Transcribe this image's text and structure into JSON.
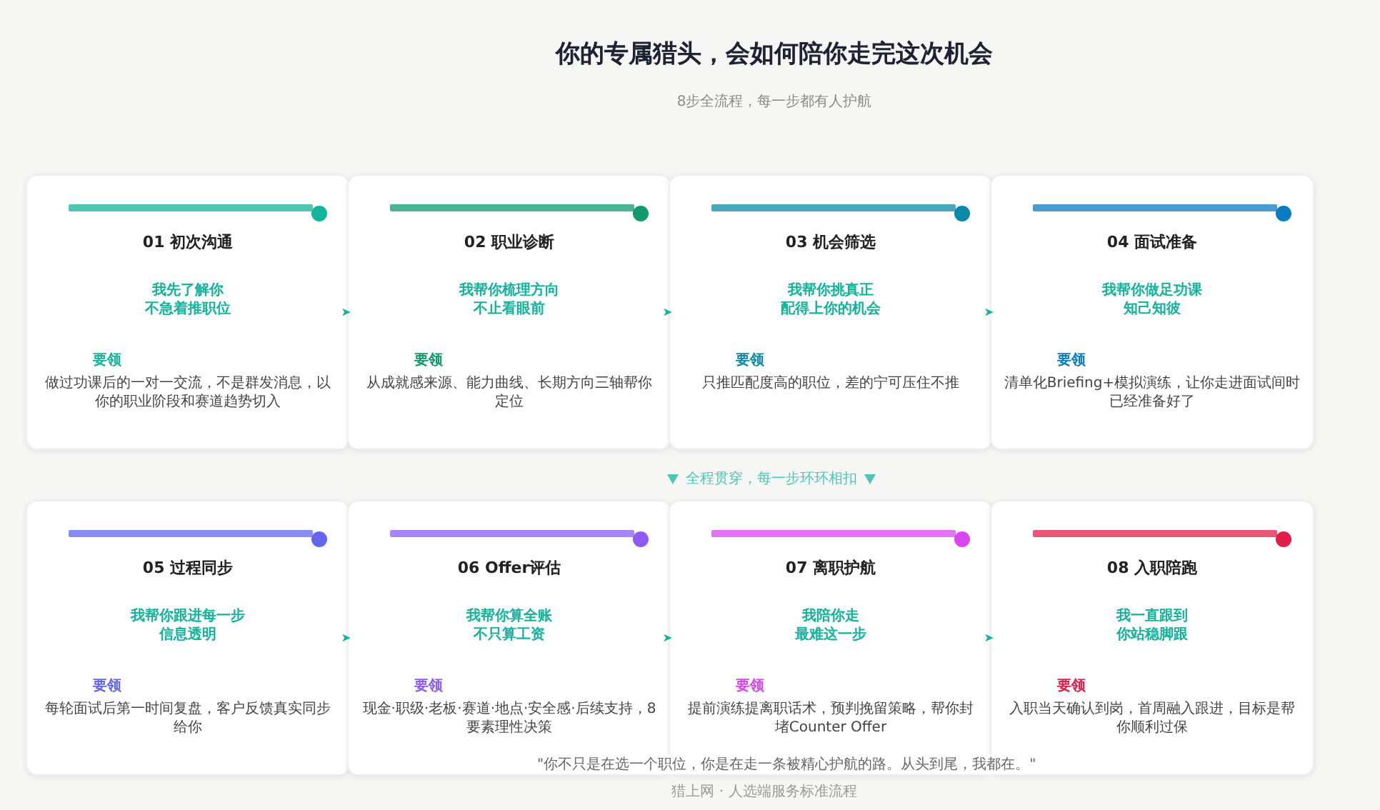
{
  "header": {
    "title": "你的专属猎头，会如何陪你走完这次机会",
    "subtitle": "8步全流程，每一步都有人护航"
  },
  "rows": [
    {
      "steps": [
        {
          "title": "01  初次沟通",
          "tagline_lines": [
            "我先了解你",
            "不急着推职位"
          ],
          "label": "要领",
          "description": "做过功课后的一对一交流，不是群发消息，以你的职业阶段和赛道趋势切入",
          "color": "#14b39b"
        },
        {
          "title": "02  职业诊断",
          "tagline_lines": [
            "我帮你梳理方向",
            "不止看眼前"
          ],
          "label": "要领",
          "description": "从成就感来源、能力曲线、长期方向三轴帮你定位",
          "color": "#0e9a6a"
        },
        {
          "title": "03  机会筛选",
          "tagline_lines": [
            "我帮你挑真正",
            "配得上你的机会"
          ],
          "label": "要领",
          "description": "只推匹配度高的职位，差的宁可压住不推",
          "color": "#0a8aa8"
        },
        {
          "title": "04  面试准备",
          "tagline_lines": [
            "我帮你做足功课",
            "知己知彼"
          ],
          "label": "要领",
          "description": "清单化Briefing+模拟演练，让你走进面试间时已经准备好了",
          "color": "#0a7cc2"
        }
      ]
    },
    {
      "steps": [
        {
          "title": "05  过程同步",
          "tagline_lines": [
            "我帮你跟进每一步",
            "信息透明"
          ],
          "label": "要领",
          "description": "每轮面试后第一时间复盘，客户反馈真实同步给你",
          "color": "#6366f1"
        },
        {
          "title": "06  Offer评估",
          "tagline_lines": [
            "我帮你算全账",
            "不只算工资"
          ],
          "label": "要领",
          "description": "现金·职级·老板·赛道·地点·安全感·后续支持，8要素理性决策",
          "color": "#8b5cf6"
        },
        {
          "title": "07  离职护航",
          "tagline_lines": [
            "我陪你走",
            "最难这一步"
          ],
          "label": "要领",
          "description": "提前演练提离职话术，预判挽留策略，帮你封堵Counter Offer",
          "color": "#d946ef"
        },
        {
          "title": "08  入职陪跑",
          "tagline_lines": [
            "我一直跟到",
            "你站稳脚跟"
          ],
          "label": "要领",
          "description": "入职当天确认到岗，首周融入跟进，目标是帮你顺利过保",
          "color": "#e11d48"
        }
      ]
    }
  ],
  "connector": "全程贯穿，每一步环环相扣",
  "quote": "\"你不只是在选一个职位，你是在走一条被精心护航的路。从头到尾，我都在。\"",
  "footer": "猎上网 · 人选端服务标准流程"
}
